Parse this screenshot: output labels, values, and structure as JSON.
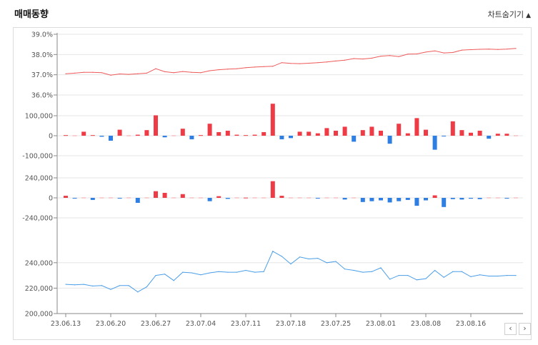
{
  "header": {
    "title": "매매동향",
    "toggle_label": "차트숨기기",
    "toggle_icon": "triangle-up-icon"
  },
  "nav": {
    "prev_icon": "chevron-left-icon",
    "next_icon": "chevron-right-icon",
    "prev_label": "‹",
    "next_label": "›"
  },
  "colors": {
    "red": "#ef3b45",
    "blue": "#2f7fe3",
    "ratio_line": "#ef5a5a",
    "price_line": "#4a9ee8",
    "grid": "#e6e6e6"
  },
  "chart_data": [
    {
      "type": "line",
      "name": "ratio",
      "ylim": [
        36.0,
        39.0
      ],
      "yticks": [
        "39.0%",
        "38.0%",
        "37.0%",
        "36.0%"
      ],
      "ytick_values": [
        39.0,
        38.0,
        37.0,
        36.0
      ],
      "values": [
        37.05,
        37.08,
        37.12,
        37.12,
        37.1,
        36.98,
        37.04,
        37.02,
        37.05,
        37.08,
        37.3,
        37.15,
        37.1,
        37.16,
        37.12,
        37.1,
        37.2,
        37.25,
        37.28,
        37.3,
        37.35,
        37.38,
        37.4,
        37.42,
        37.6,
        37.56,
        37.55,
        37.57,
        37.6,
        37.63,
        37.68,
        37.72,
        37.8,
        37.78,
        37.82,
        37.92,
        37.95,
        37.9,
        38.02,
        38.03,
        38.12,
        38.18,
        38.08,
        38.1,
        38.22,
        38.24,
        38.26,
        38.27,
        38.25,
        38.27,
        38.3
      ]
    },
    {
      "type": "bar",
      "name": "volume-1",
      "ylim": [
        -100000,
        100000
      ],
      "yticks": [
        "100,000",
        "0",
        "-100,000"
      ],
      "ytick_values": [
        100000,
        0,
        -100000
      ],
      "values": [
        3000,
        0,
        20000,
        3000,
        -5000,
        -25000,
        30000,
        0,
        5000,
        28000,
        102000,
        -8000,
        0,
        35000,
        -18000,
        3000,
        60000,
        18000,
        25000,
        5000,
        3000,
        5000,
        18000,
        160000,
        -18000,
        -12000,
        20000,
        20000,
        12000,
        38000,
        25000,
        45000,
        -30000,
        28000,
        45000,
        25000,
        -40000,
        60000,
        12000,
        88000,
        30000,
        -70000,
        -3000,
        72000,
        28000,
        15000,
        25000,
        -15000,
        10000,
        10000,
        0
      ]
    },
    {
      "type": "bar",
      "name": "volume-2",
      "ylim": [
        -240000,
        240000
      ],
      "yticks": [
        "240,000",
        "0",
        "-240,000"
      ],
      "ytick_values": [
        240000,
        0,
        -240000
      ],
      "values": [
        25000,
        -3000,
        0,
        -25000,
        0,
        0,
        -8000,
        0,
        -60000,
        0,
        80000,
        60000,
        0,
        45000,
        0,
        0,
        -40000,
        20000,
        -12000,
        0,
        3000,
        0,
        0,
        200000,
        25000,
        0,
        0,
        0,
        -3000,
        0,
        0,
        -20000,
        0,
        -50000,
        -40000,
        -30000,
        -55000,
        -40000,
        -25000,
        -95000,
        -30000,
        30000,
        -110000,
        -15000,
        -20000,
        -10000,
        -15000,
        0,
        0,
        -8000,
        0
      ]
    },
    {
      "type": "line",
      "name": "price",
      "ylim": [
        200000,
        250000
      ],
      "yticks": [
        "240,000",
        "220,000",
        "200,000"
      ],
      "ytick_values": [
        240000,
        220000,
        200000
      ],
      "categories": [
        "23.06.13",
        "23.06.20",
        "23.06.27",
        "23.07.04",
        "23.07.11",
        "23.07.18",
        "23.07.25",
        "23.08.01",
        "23.08.08",
        "23.08.16"
      ],
      "values": [
        223000,
        222600,
        223000,
        221700,
        222000,
        219000,
        222000,
        222000,
        217000,
        221000,
        230000,
        231000,
        226000,
        232500,
        232000,
        230500,
        232000,
        233000,
        232500,
        232500,
        234000,
        232500,
        233000,
        249000,
        245000,
        239000,
        244500,
        243000,
        243500,
        240000,
        241000,
        235000,
        234000,
        232500,
        233000,
        236000,
        227000,
        230000,
        230000,
        226500,
        227500,
        234000,
        228500,
        233000,
        233000,
        229000,
        230500,
        229500,
        229500,
        230000,
        230000
      ]
    }
  ]
}
